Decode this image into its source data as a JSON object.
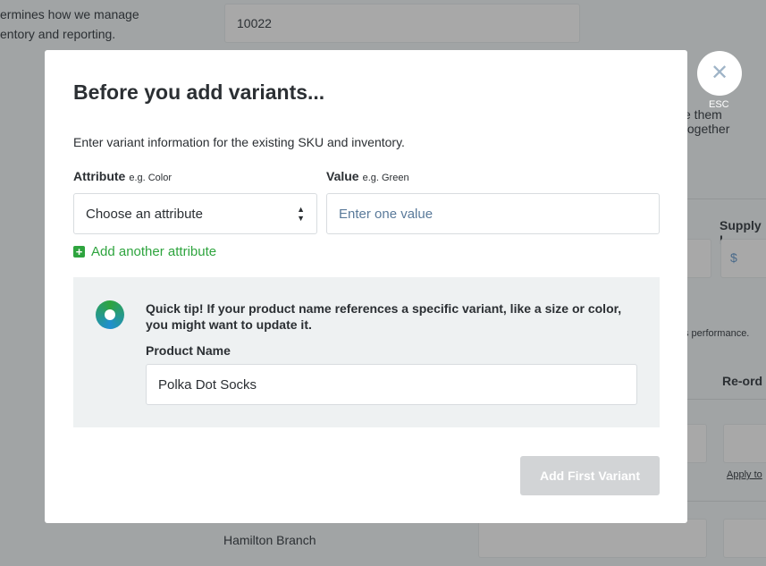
{
  "background": {
    "desc_line1": "ermines how we manage",
    "desc_line2": "entory and reporting.",
    "zip_value": "10022",
    "together_text": "e them together",
    "supply_label": "Supply I",
    "price_placeholder": "$",
    "performance_text": "s performance.",
    "reorder_label": "Re-ord",
    "apply_link": "Apply to",
    "branch_label": "Hamilton Branch"
  },
  "modal": {
    "title": "Before you add variants...",
    "intro": "Enter variant information for the existing SKU and inventory.",
    "attribute_label": "Attribute",
    "attribute_hint": "e.g. Color",
    "attribute_select": "Choose an attribute",
    "value_label": "Value",
    "value_hint": "e.g. Green",
    "value_placeholder": "Enter one value",
    "add_attribute": "Add another attribute",
    "tip": "Quick tip! If your product name references a specific variant, like a size or color, you might want to update it.",
    "product_name_label": "Product Name",
    "product_name_value": "Polka Dot Socks",
    "submit": "Add First Variant"
  },
  "close": {
    "label": "ESC",
    "icon": "close-icon"
  },
  "colors": {
    "accent": "#2ea43e",
    "overlay": "#a1a4a5",
    "button_disabled": "#d2d4d6"
  }
}
